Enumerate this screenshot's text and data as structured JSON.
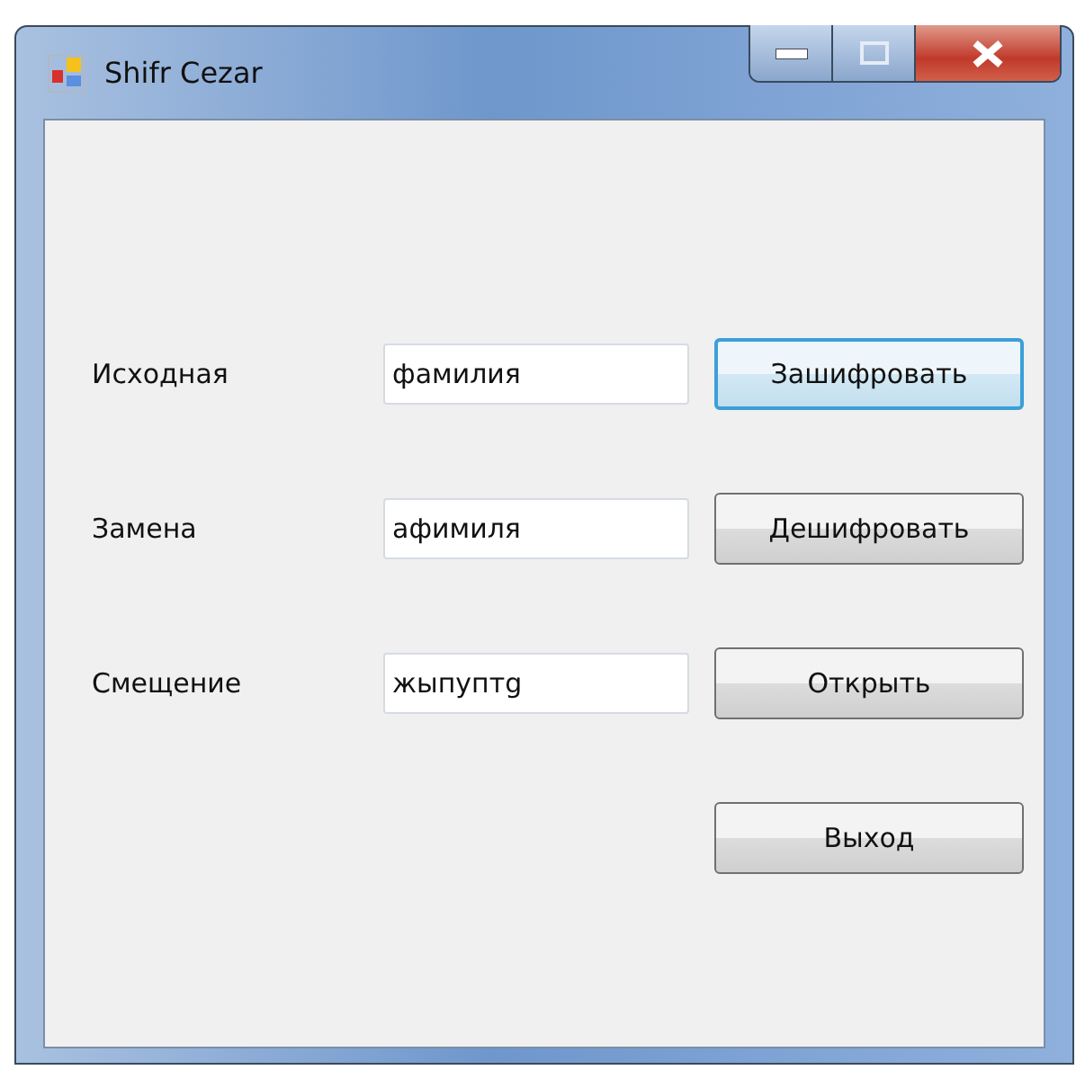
{
  "window": {
    "title": "Shifr Cezar"
  },
  "rows": [
    {
      "label": "Исходная",
      "value": "фамилия",
      "button": {
        "label": "Зашифровать",
        "focused": true
      }
    },
    {
      "label": "Замена",
      "value": "афимиля",
      "button": {
        "label": "Дешифровать",
        "focused": false
      }
    },
    {
      "label": "Смещение",
      "value": "жыпуптg",
      "button": {
        "label": "Открыть",
        "focused": false
      }
    }
  ],
  "exit_button": {
    "label": "Выход",
    "focused": false
  }
}
